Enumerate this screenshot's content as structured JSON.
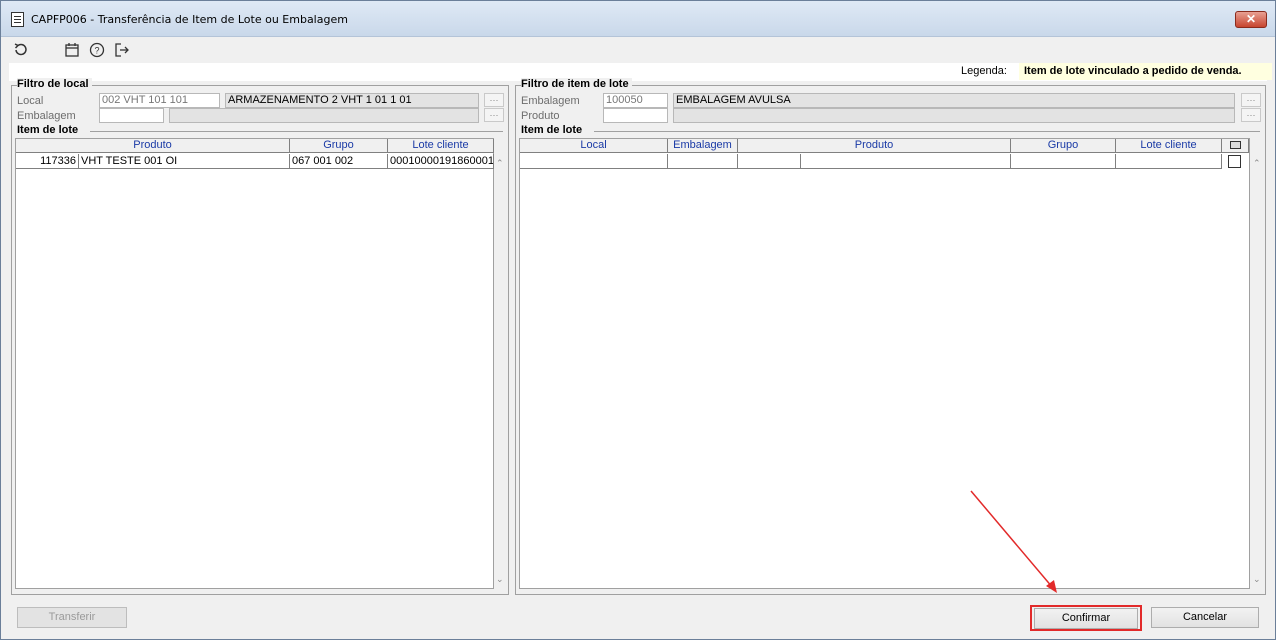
{
  "window": {
    "title": "CAPFP006 - Transferência de Item de Lote ou Embalagem",
    "close_label": "✕"
  },
  "toolbar": {
    "icons": [
      "refresh-icon",
      "calendar-icon",
      "help-icon",
      "exit-icon"
    ]
  },
  "legend": {
    "label": "Legenda:",
    "value": "Item de lote vinculado a pedido de venda.",
    "color": "#ffffe0"
  },
  "left_panel": {
    "filter_title": "Filtro de local",
    "local_label": "Local",
    "local_code": "002 VHT 101 101",
    "local_desc": "ARMAZENAMENTO 2 VHT 1 01 1 01",
    "embalagem_label": "Embalagem",
    "embalagem_code": "",
    "embalagem_desc": "",
    "items_title": "Item de lote",
    "columns": [
      "Produto",
      "Grupo",
      "Lote cliente"
    ],
    "rows": [
      {
        "code": "117336",
        "produto": "VHT TESTE 001 OI",
        "grupo": "067 001 002",
        "lote": "00010000191860001"
      }
    ]
  },
  "right_panel": {
    "filter_title": "Filtro de item de lote",
    "embalagem_label": "Embalagem",
    "embalagem_code": "100050",
    "embalagem_desc": "EMBALAGEM AVULSA",
    "produto_label": "Produto",
    "produto_code": "",
    "produto_desc": "",
    "items_title": "Item de lote",
    "columns": [
      "Local",
      "Embalagem",
      "Produto",
      "Grupo",
      "Lote cliente"
    ]
  },
  "buttons": {
    "transferir": "Transferir",
    "confirmar": "Confirmar",
    "cancelar": "Cancelar"
  },
  "accent_colors": {
    "highlight": "#e22a2a",
    "header_text": "#1a3aa6"
  }
}
